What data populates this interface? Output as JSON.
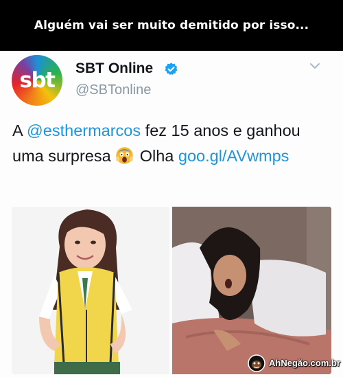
{
  "meme": {
    "caption": "Alguém vai ser muito demitido por isso..."
  },
  "tweet": {
    "avatar_text": "sbt",
    "author_name": "SBT Online",
    "handle": "@SBTonline",
    "text_prefix": "A ",
    "mention": "@esthermarcos",
    "text_middle": " fez 15 anos e ganhou uma surpresa ",
    "emoji_icon": "screaming-face-emoji",
    "text_after_emoji": " Olha ",
    "link": "goo.gl/AVwmps",
    "media": [
      {
        "alt": "girl-in-yellow-school-vest-photo"
      },
      {
        "alt": "woman-on-bed-photo"
      }
    ]
  },
  "watermark": {
    "text": "AhNegão.com.br"
  },
  "colors": {
    "link": "#1b95e0",
    "verified": "#1da1f2",
    "handle": "#8899a6"
  }
}
